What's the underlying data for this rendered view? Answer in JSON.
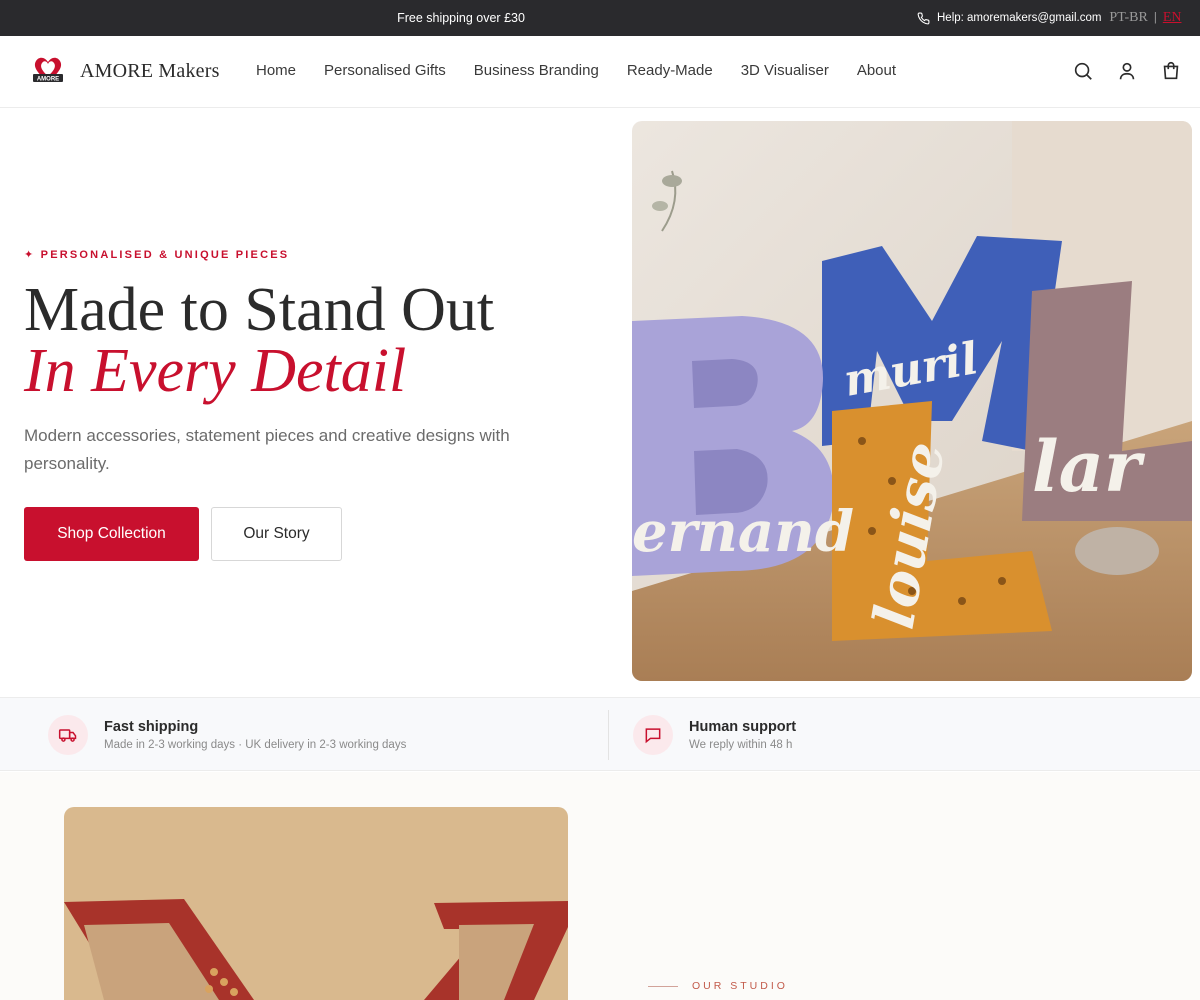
{
  "topbar": {
    "shipping": "Free shipping over £30",
    "help": "Help: amoremakers@gmail.com",
    "lang_pt": "PT-BR",
    "lang_sep": "|",
    "lang_en": "EN"
  },
  "header": {
    "brand": "AMORE Makers",
    "logo_text": "AMORE",
    "nav": [
      "Home",
      "Personalised Gifts",
      "Business Branding",
      "Ready-Made",
      "3D Visualiser",
      "About"
    ]
  },
  "hero": {
    "eyebrow": "✦ PERSONALISED & UNIQUE PIECES",
    "title_line1": "Made to Stand Out",
    "title_line2": "In Every Detail",
    "subtitle": "Modern accessories, statement pieces and creative designs with personality.",
    "primary_cta": "Shop Collection",
    "secondary_cta": "Our Story",
    "image_words": [
      "ernand",
      "louise",
      "lar",
      "muril"
    ]
  },
  "features": [
    {
      "title": "Fast shipping",
      "desc": "Made in 2-3 working days · UK delivery in 2-3 working days",
      "icon": "truck-icon"
    },
    {
      "title": "Human support",
      "desc": "We reply within 48 h",
      "icon": "chat-icon"
    }
  ],
  "studio": {
    "label": "OUR STUDIO"
  },
  "colors": {
    "accent": "#c8102e",
    "topbar": "#2a2a2d",
    "feature_bg": "#f8f9fb"
  }
}
